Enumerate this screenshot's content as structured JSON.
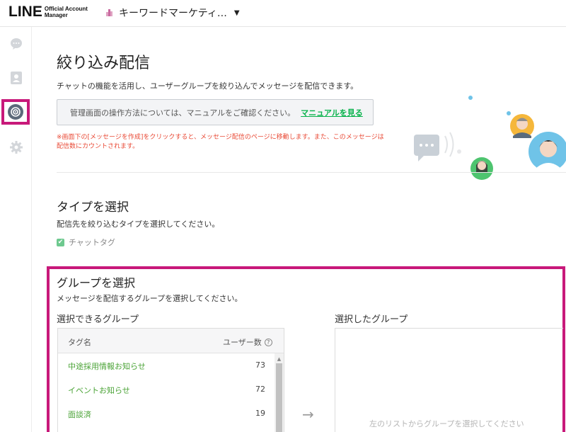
{
  "header": {
    "logo_main": "LINE",
    "logo_sub_1": "Official Account",
    "logo_sub_2": "Manager",
    "account_name": "キーワードマーケティ…"
  },
  "sidebar": {
    "items": [
      {
        "icon": "chat-icon"
      },
      {
        "icon": "contacts-icon"
      },
      {
        "icon": "broadcast-icon",
        "active": true
      },
      {
        "icon": "gear-icon"
      }
    ]
  },
  "page": {
    "title": "絞り込み配信",
    "description": "チャットの機能を活用し、ユーザーグループを絞り込んでメッセージを配信できます。",
    "notice_text": "管理画面の操作方法については、マニュアルをご確認ください。",
    "notice_link": "マニュアルを見る",
    "warning_line1": "※画面下の[メッセージを作成]をクリックすると、メッセージ配信のページに移動します。また、このメッセージは",
    "warning_line2": "配信数にカウントされます。"
  },
  "type_section": {
    "title": "タイプを選択",
    "description": "配信先を絞り込むタイプを選択してください。",
    "option_label": "チャットタグ"
  },
  "group_section": {
    "title": "グループを選択",
    "description": "メッセージを配信するグループを選択してください。",
    "available_label": "選択できるグループ",
    "selected_label": "選択したグループ",
    "col_tag": "タグ名",
    "col_users": "ユーザー数",
    "rows": [
      {
        "name": "中途採用情報お知らせ",
        "count": "73"
      },
      {
        "name": "イベントお知らせ",
        "count": "72"
      },
      {
        "name": "面談済",
        "count": "19"
      }
    ],
    "selected_placeholder": "左のリストからグループを選択してください"
  },
  "colors": {
    "highlight": "#c8197a",
    "link_green": "#06b24a",
    "tag_green": "#4aa336",
    "warning_red": "#e94a36"
  }
}
